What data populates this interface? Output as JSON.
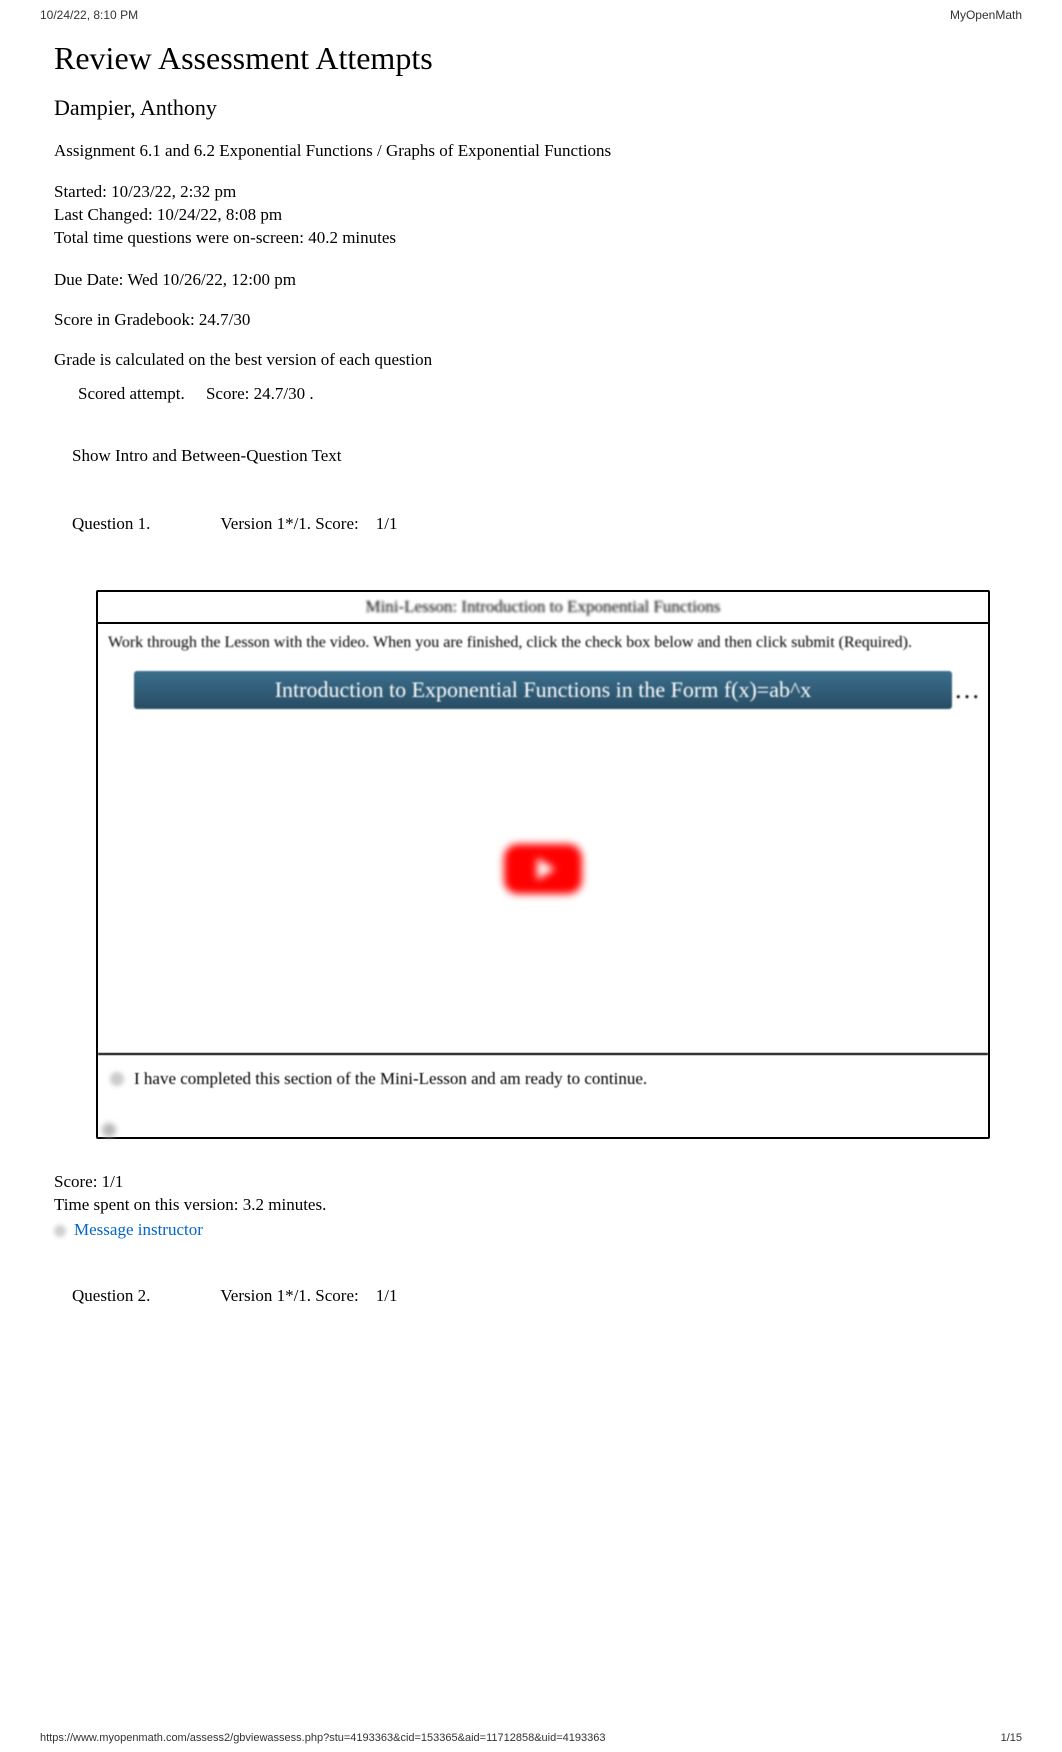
{
  "print_header": {
    "datetime": "10/24/22, 8:10 PM",
    "site": "MyOpenMath"
  },
  "page": {
    "title": "Review Assessment Attempts",
    "student": "Dampier, Anthony",
    "assignment": "Assignment 6.1 and 6.2 Exponential Functions / Graphs of Exponential Functions"
  },
  "meta": {
    "started": "Started: 10/23/22, 2:32 pm",
    "last_changed": "Last Changed: 10/24/22, 8:08 pm",
    "total_time": "Total time questions were on-screen: 40.2 minutes",
    "due_date": "Due Date: Wed 10/26/22, 12:00 pm",
    "gradebook": "Score in Gradebook: 24.7/30",
    "grade_calc": "Grade is calculated on the best version of each question",
    "scored_attempt_label": "Scored attempt.",
    "scored_attempt_score": "Score:  24.7/30  ."
  },
  "intro_button": "Show Intro and Between-Question Text",
  "q1": {
    "label": "Question 1.",
    "version": "Version 1*/1. Score:",
    "score": "1/1",
    "mini_lesson_title": "Mini-Lesson: Introduction to Exponential Functions",
    "mini_lesson_desc": "Work through the Lesson with the video. When you are finished, click the check box below and then click submit (Required).",
    "video_title": "Introduction to Exponential Functions in the Form f(x)=ab^x",
    "video_ellipsis": "…",
    "checkbox_label": "I have completed this section of the Mini-Lesson and am ready to continue.",
    "result_score": "Score: 1/1",
    "time_spent": "Time spent on this version: 3.2 minutes.",
    "msg_link": "Message instructor"
  },
  "q2": {
    "label": "Question 2.",
    "version": "Version 1*/1. Score:",
    "score": "1/1"
  },
  "print_footer": {
    "url": "https://www.myopenmath.com/assess2/gbviewassess.php?stu=4193363&cid=153365&aid=11712858&uid=4193363",
    "page": "1/15"
  }
}
